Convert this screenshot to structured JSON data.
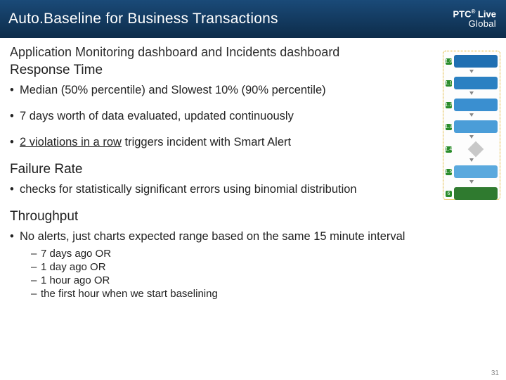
{
  "header": {
    "title": "Auto.Baseline for Business Transactions",
    "brand_top": "PTC",
    "brand_sup": "®",
    "brand_live": " Live",
    "brand_bot": "Global"
  },
  "subtitle": "Application Monitoring dashboard and Incidents dashboard",
  "sections": {
    "response_time": {
      "heading": "Response Time",
      "bullets": [
        {
          "plain": "Median (50% percentile) and Slowest 10% (90% percentile)"
        },
        {
          "plain": "7 days worth of data evaluated, updated continuously"
        },
        {
          "underlined": "2 violations in a row",
          "rest": " triggers incident with Smart Alert"
        }
      ]
    },
    "failure_rate": {
      "heading": "Failure Rate",
      "bullets": [
        {
          "plain": "checks for statistically significant errors using binomial distribution"
        }
      ]
    },
    "throughput": {
      "heading": "Throughput",
      "bullets": [
        {
          "plain": "No alerts, just charts expected range based on the same 15 minute interval",
          "sub": [
            "7 days ago OR",
            "1 day ago OR",
            "1 hour ago OR",
            "the first hour when we start baselining"
          ]
        }
      ]
    }
  },
  "flow": {
    "steps": [
      "1.0",
      "1.1",
      "1.2",
      "1.3",
      "1.4",
      "1.5",
      "6"
    ],
    "labels": [
      "",
      "",
      "",
      "",
      "",
      "",
      ""
    ]
  },
  "page_number": "31"
}
